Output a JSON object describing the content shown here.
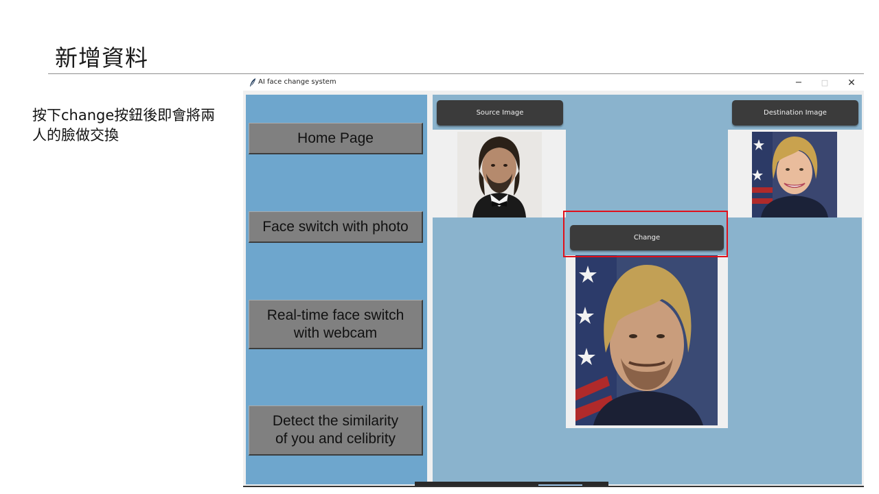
{
  "slide": {
    "title": "新增資料",
    "description": "按下change按鈕後即會將兩人的臉做交換"
  },
  "window": {
    "title": "AI face change system",
    "minimize_glyph": "−",
    "maximize_glyph": "□",
    "close_glyph": "✕",
    "app_icon": "feather-icon"
  },
  "sidebar": {
    "background": "#6ea6cd",
    "items": [
      {
        "label": "Home Page"
      },
      {
        "label": "Face switch with photo"
      },
      {
        "label": "Real-time face switch\nwith webcam"
      },
      {
        "label": "Detect the similarity\nof you and celibrity"
      }
    ]
  },
  "main": {
    "background": "#8ab3cd",
    "source_button": "Source Image",
    "destination_button": "Destination Image",
    "change_button": "Change",
    "highlight_color": "#e0101a"
  }
}
